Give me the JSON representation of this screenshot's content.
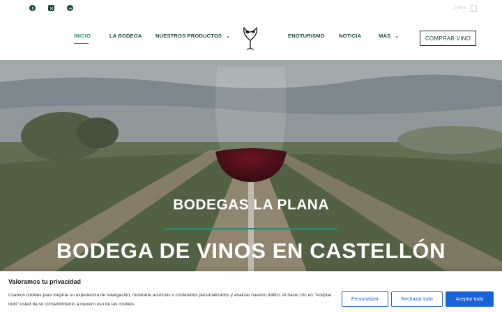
{
  "header": {
    "social": [
      {
        "name": "facebook"
      },
      {
        "name": "x-twitter"
      },
      {
        "name": "tripadvisor"
      }
    ],
    "cart_label": "0,00 €",
    "nav_left": [
      {
        "label": "INICIO",
        "active": true
      },
      {
        "label": "LA BODEGA",
        "active": false
      },
      {
        "label": "NUESTROS PRODUCTOS",
        "active": false,
        "dropdown": true
      }
    ],
    "nav_right": [
      {
        "label": "ENOTURISMO",
        "active": false
      },
      {
        "label": "NOTICIA",
        "active": false
      },
      {
        "label": "MÁS",
        "active": false,
        "dropdown": true
      }
    ],
    "buy_button": "COMPRAR VINO"
  },
  "hero": {
    "subtitle": "BODEGAS LA PLANA",
    "title": "BODEGA DE VINOS EN CASTELLÓN"
  },
  "cookie": {
    "title": "Valoramos tu privacidad",
    "text": "Usamos cookies para mejorar su experiencia de navegación, mostrarle anuncios o contenidos personalizados y analizar nuestro tráfico. Al hacer clic en \"Aceptar todo\" usted da su consentimiento a nuestro uso de las cookies.",
    "buttons": {
      "customize": "Personalizar",
      "reject": "Rechazar todo",
      "accept": "Aceptar todo"
    }
  },
  "colors": {
    "brand_green": "#1e4a3f",
    "accent_green": "#2f8a6e",
    "cookie_blue": "#1863dc"
  }
}
